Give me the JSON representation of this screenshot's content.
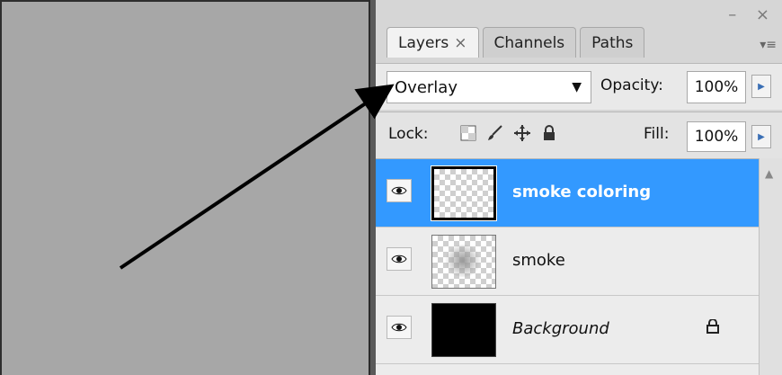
{
  "panel": {
    "tabs": [
      {
        "label": "Layers",
        "close": "×"
      },
      {
        "label": "Channels"
      },
      {
        "label": "Paths"
      }
    ],
    "window_controls": "– ×",
    "menu_glyph": "▾≡"
  },
  "blend": {
    "value": "Overlay",
    "caret": "▼"
  },
  "opacity": {
    "label": "Opacity:",
    "value": "100%"
  },
  "lock": {
    "label": "Lock:"
  },
  "fill": {
    "label": "Fill:",
    "value": "100%"
  },
  "layers": [
    {
      "name": "smoke coloring",
      "selected": true
    },
    {
      "name": "smoke",
      "selected": false
    },
    {
      "name": "Background",
      "selected": false,
      "locked": true
    }
  ],
  "icons": {
    "eye": "eye-icon",
    "lock_transparent": "lock-transparent-icon",
    "lock_image": "brush-icon",
    "lock_position": "move-icon",
    "lock_all": "lock-icon",
    "stepper": "triangle-right-icon"
  },
  "colors": {
    "selection": "#3399ff",
    "canvas": "#a7a7a7"
  }
}
